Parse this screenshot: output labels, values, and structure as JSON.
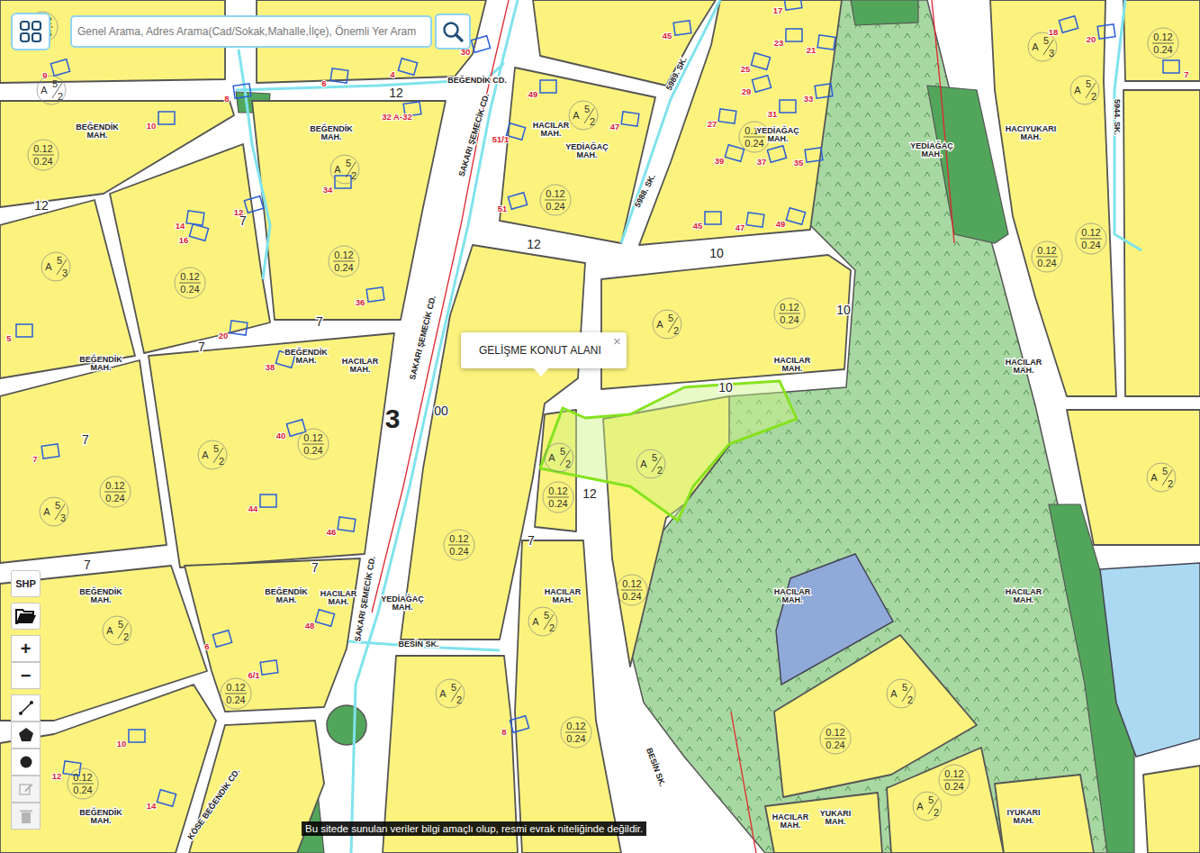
{
  "search": {
    "placeholder": "Genel Arama, Adres Arama(Cad/Sokak,Mahalle,İlçe), Önemli Yer Aram"
  },
  "popup": {
    "text": "GELİŞME KONUT ALANI",
    "close": "×"
  },
  "toolbar": {
    "shp": "SHP",
    "zoom_in": "+",
    "zoom_out": "−"
  },
  "draw_tools": [
    {
      "kind": "line",
      "disabled": false
    },
    {
      "kind": "polygon",
      "disabled": false
    },
    {
      "kind": "circle",
      "disabled": false
    },
    {
      "kind": "edit",
      "disabled": true
    },
    {
      "kind": "delete",
      "disabled": true
    }
  ],
  "disclaimer": "Bu sitede sunulan veriler bilgi amaçlı olup, resmi evrak niteliğinde değildir.",
  "map": {
    "streets": [
      {
        "text": "BEĞENDİK CD."
      },
      {
        "text": "SAKARI ŞEMECİK CD."
      },
      {
        "text": "SAKARI ŞEMECİK CD."
      },
      {
        "text": "SAKARI ŞEMECİK CD."
      },
      {
        "text": "5989. SK."
      },
      {
        "text": "5988. SK."
      },
      {
        "text": "5944. SK."
      },
      {
        "text": "BESİN SK."
      },
      {
        "text": "BESİN SK."
      },
      {
        "text": "KÖSE BEĞENDİK CD."
      }
    ],
    "neighborhoods": [
      {
        "name": "BEĞENDİK",
        "suffix": "MAH."
      },
      {
        "name": "BEĞENDİK",
        "suffix": "MAH."
      },
      {
        "name": "HACILAR",
        "suffix": "MAH."
      },
      {
        "name": "YEDİAĞAÇ",
        "suffix": "MAH."
      },
      {
        "name": "YEDİAĞAÇ",
        "suffix": "MAH."
      },
      {
        "name": "YEDİAĞAÇ",
        "suffix": "MAH."
      },
      {
        "name": "HACIYUKARI",
        "suffix": "MAH."
      },
      {
        "name": "BEĞENDİK",
        "suffix": "MAH."
      },
      {
        "name": "BEĞENDİK",
        "suffix": "MAH."
      },
      {
        "name": "HACILAR",
        "suffix": "MAH."
      },
      {
        "name": "HACILAR",
        "suffix": "MAH."
      },
      {
        "name": "HACILAR",
        "suffix": "MAH."
      },
      {
        "name": "BEĞENDİK",
        "suffix": "MAH."
      },
      {
        "name": "BEĞENDİK",
        "suffix": "MAH."
      },
      {
        "name": "HACILAR",
        "suffix": "MAH."
      },
      {
        "name": "YEDİAĞAÇ",
        "suffix": "MAH."
      },
      {
        "name": "HACILAR",
        "suffix": "MAH."
      },
      {
        "name": "HACILAR",
        "suffix": "MAH."
      },
      {
        "name": "HACILAR",
        "suffix": "MAH."
      },
      {
        "name": "BEĞENDİK",
        "suffix": "MAH."
      },
      {
        "name": "HACILAR",
        "suffix": "MAH."
      },
      {
        "name": "YUKARI",
        "suffix": "MAH."
      },
      {
        "name": "IYUKARI",
        "suffix": "MAH."
      }
    ],
    "densities": [
      {
        "top": "0.12",
        "bottom": "0.24"
      },
      {
        "top": "0.12",
        "bottom": "0.24"
      },
      {
        "top": "0.12",
        "bottom": "0.24"
      },
      {
        "top": "0.12",
        "bottom": "0.24"
      },
      {
        "top": "0.12",
        "bottom": "0.24"
      },
      {
        "top": "0.12",
        "bottom": "0.24"
      },
      {
        "top": "0.12",
        "bottom": "0.24"
      },
      {
        "top": "0.12",
        "bottom": "0.24"
      },
      {
        "top": "0.12",
        "bottom": "0.24"
      },
      {
        "top": "0.12",
        "bottom": "0.24"
      },
      {
        "top": "0.12",
        "bottom": "0.24"
      },
      {
        "top": "0.12",
        "bottom": "0.24"
      },
      {
        "top": "0.12",
        "bottom": "0.24"
      },
      {
        "top": "0.12",
        "bottom": "0.24"
      },
      {
        "top": "0.12",
        "bottom": "0.24"
      },
      {
        "top": "0.12",
        "bottom": "0.24"
      },
      {
        "top": "0.12",
        "bottom": "0.24"
      },
      {
        "top": "0.12",
        "bottom": "0.24"
      },
      {
        "top": "0.12",
        "bottom": "0.24"
      },
      {
        "top": "0.12",
        "bottom": "0.24"
      }
    ],
    "heights": [
      {
        "letter": "A",
        "top": "5",
        "bottom": "2"
      },
      {
        "letter": "A",
        "top": "5",
        "bottom": "2"
      },
      {
        "letter": "A",
        "top": "5",
        "bottom": "2"
      },
      {
        "letter": "A",
        "top": "5",
        "bottom": "3"
      },
      {
        "letter": "A",
        "top": "5",
        "bottom": "2"
      },
      {
        "letter": "A",
        "top": "5",
        "bottom": "3"
      },
      {
        "letter": "A",
        "top": "5",
        "bottom": "2"
      },
      {
        "letter": "A",
        "top": "5",
        "bottom": "2"
      },
      {
        "letter": "A",
        "top": "5",
        "bottom": "2"
      },
      {
        "letter": "A",
        "top": "5",
        "bottom": "2"
      },
      {
        "letter": "A",
        "top": "5",
        "bottom": "3"
      },
      {
        "letter": "A",
        "top": "5",
        "bottom": "2"
      },
      {
        "letter": "A",
        "top": "5",
        "bottom": "2"
      },
      {
        "letter": "A",
        "top": "5",
        "bottom": "2"
      },
      {
        "letter": "A",
        "top": "5",
        "bottom": "2"
      },
      {
        "letter": "A",
        "top": "5",
        "bottom": "2"
      },
      {
        "letter": "A",
        "top": "5",
        "bottom": "2"
      }
    ],
    "road_widths": [
      {
        "text": "12",
        "kind": "small"
      },
      {
        "text": "12",
        "kind": "small"
      },
      {
        "text": "7",
        "kind": "small"
      },
      {
        "text": "7",
        "kind": "small"
      },
      {
        "text": "7",
        "kind": "small"
      },
      {
        "text": "7",
        "kind": "small"
      },
      {
        "text": "12",
        "kind": "small"
      },
      {
        "text": "10",
        "kind": "small"
      },
      {
        "text": "10",
        "kind": "small"
      },
      {
        "text": "10",
        "kind": "small"
      },
      {
        "text": "12",
        "kind": "small"
      },
      {
        "text": "7",
        "kind": "small"
      },
      {
        "text": "7",
        "kind": "small"
      },
      {
        "text": "7",
        "kind": "small"
      },
      {
        "text": "3",
        "kind": "large"
      },
      {
        "text": "00",
        "kind": "small"
      }
    ],
    "parcel_numbers": [
      "9",
      "8",
      "10",
      "6",
      "4",
      "30",
      "32 A-32",
      "34",
      "14",
      "16",
      "12",
      "36",
      "5",
      "20",
      "38",
      "40",
      "7",
      "44",
      "46",
      "48",
      "6",
      "6/1",
      "10",
      "12",
      "14",
      "8",
      "45",
      "49",
      "47",
      "51/1",
      "51",
      "17",
      "23",
      "21",
      "25",
      "29",
      "33",
      "31",
      "27",
      "39",
      "37",
      "35",
      "45",
      "47",
      "49",
      "18",
      "20",
      "7"
    ]
  }
}
